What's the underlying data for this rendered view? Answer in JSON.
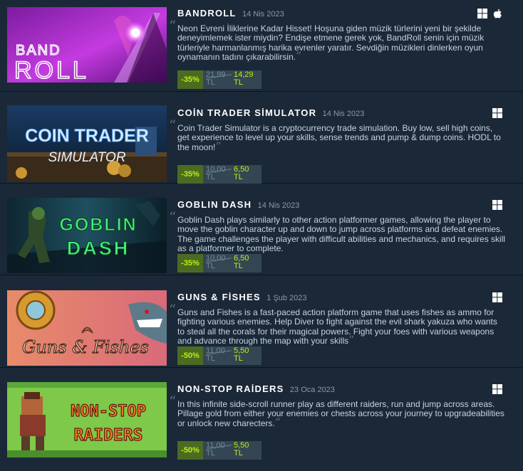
{
  "items": [
    {
      "title": "BANDROLL",
      "date": "14 Nis 2023",
      "platforms": [
        "windows-icon",
        "apple-icon"
      ],
      "description": "Neon Evreni İliklerine Kadar Hisset! Hoşuna giden müzik türlerini yeni bir şekilde deneyimlemek ister miydin? Endişe etmene gerek yok, BandRoll senin için müzik türleriyle harmanlanmış harika evrenler yaratır. Sevdiğin müzikleri dinlerken oyun oynamanın tadını çıkarabilirsin.",
      "discount": "-35%",
      "original_price": "21,99",
      "original_currency": "TL",
      "final_price": "14,29",
      "final_currency": "TL",
      "capsule_text_1": "BAND",
      "capsule_text_2": "ROLL"
    },
    {
      "title": "COİN TRADER SİMULATOR",
      "date": "14 Nis 2023",
      "platforms": [
        "windows-icon"
      ],
      "description": "Coin Trader Simulator is a cryptocurrency trade simulation. Buy low, sell high coins, get experience to level up your skills, sense trends and pump & dump coins. HODL to the moon!",
      "discount": "-35%",
      "original_price": "10,00",
      "original_currency": "TL",
      "final_price": "6,50",
      "final_currency": "TL",
      "capsule_text_1": "COIN TRADER",
      "capsule_text_2": "SIMULATOR"
    },
    {
      "title": "GOBLIN DASH",
      "date": "14 Nis 2023",
      "platforms": [
        "windows-icon"
      ],
      "description": "Goblin Dash plays similarly to other action platformer games, allowing the player to move the goblin character up and down to jump across platforms and defeat enemies. The game challenges the player with difficult abilities and mechanics, and requires skill as a platformer to complete.",
      "discount": "-35%",
      "original_price": "10,00",
      "original_currency": "TL",
      "final_price": "6,50",
      "final_currency": "TL",
      "capsule_text_1": "GOBLIN",
      "capsule_text_2": "DASH"
    },
    {
      "title": "GUNS & FİSHES",
      "date": "1 Şub 2023",
      "platforms": [
        "windows-icon"
      ],
      "description": "Guns and Fishes is a fast-paced action platform game that uses fishes as ammo for fighting various enemies. Help Diver to fight against the evil shark yakuza who wants to steal all the corals for their magical powers. Fight your foes with various weapons and advance through the map with your skills",
      "discount": "-50%",
      "original_price": "11,00",
      "original_currency": "TL",
      "final_price": "5,50",
      "final_currency": "TL",
      "capsule_text_1": "Guns & Fishes"
    },
    {
      "title": "NON-STOP RAİDERS",
      "date": "23 Oca 2023",
      "platforms": [
        "windows-icon"
      ],
      "description": "In this infinite side-scroll runner play as different raiders, run and jump across areas. Pillage gold from either your enemies or chests across your journey to upgradeabilities or unlock new charecters.",
      "discount": "-50%",
      "original_price": "11,00",
      "original_currency": "TL",
      "final_price": "5,50",
      "final_currency": "TL",
      "capsule_text_1": "NON-STOP",
      "capsule_text_2": "RAIDERS"
    }
  ],
  "colors": {
    "background": "#1b2838",
    "discount_bg": "#4c6b22",
    "discount_text": "#beee11",
    "price_bg": "#344654"
  }
}
